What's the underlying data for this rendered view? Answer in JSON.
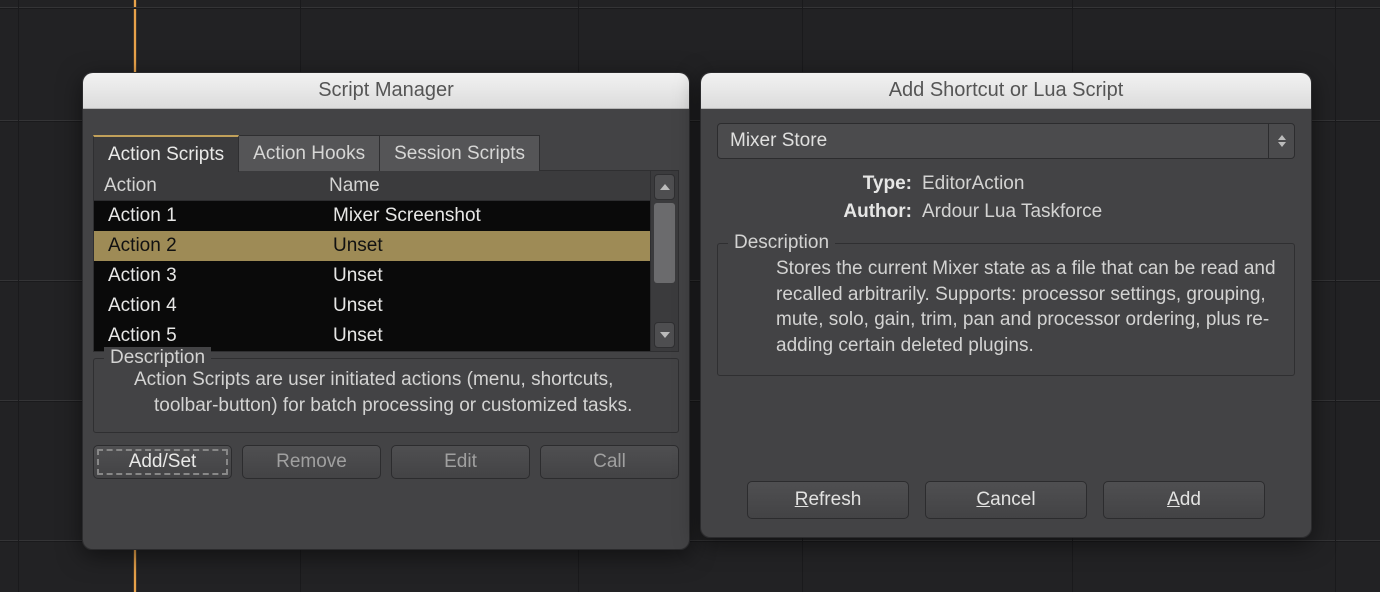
{
  "script_manager": {
    "title": "Script Manager",
    "tabs": [
      {
        "label": "Action Scripts",
        "active": true
      },
      {
        "label": "Action Hooks",
        "active": false
      },
      {
        "label": "Session Scripts",
        "active": false
      }
    ],
    "columns": {
      "action": "Action",
      "name": "Name"
    },
    "rows": [
      {
        "action": "Action 1",
        "name": "Mixer Screenshot",
        "selected": false
      },
      {
        "action": "Action 2",
        "name": "Unset",
        "selected": true
      },
      {
        "action": "Action 3",
        "name": "Unset",
        "selected": false
      },
      {
        "action": "Action 4",
        "name": "Unset",
        "selected": false
      },
      {
        "action": "Action 5",
        "name": "Unset",
        "selected": false
      }
    ],
    "description_label": "Description",
    "description_text": "Action Scripts are user initiated actions (menu, shortcuts, toolbar-button) for batch processing or customized tasks.",
    "buttons": {
      "addset": "Add/Set",
      "remove": "Remove",
      "edit": "Edit",
      "call": "Call"
    }
  },
  "add_script": {
    "title": "Add Shortcut or Lua Script",
    "script_select": "Mixer Store",
    "type_label": "Type:",
    "type_value": "EditorAction",
    "author_label": "Author:",
    "author_value": "Ardour Lua Taskforce",
    "description_label": "Description",
    "description_text": "Stores the current Mixer state as a file that can be read and recalled arbitrarily. Supports: processor settings, grouping, mute, solo, gain, trim, pan and processor ordering, plus re-adding certain deleted plugins.",
    "buttons": {
      "refresh": {
        "accel": "R",
        "rest": "efresh"
      },
      "cancel": {
        "accel": "C",
        "rest": "ancel"
      },
      "add": {
        "accel": "A",
        "rest": "dd"
      }
    }
  }
}
